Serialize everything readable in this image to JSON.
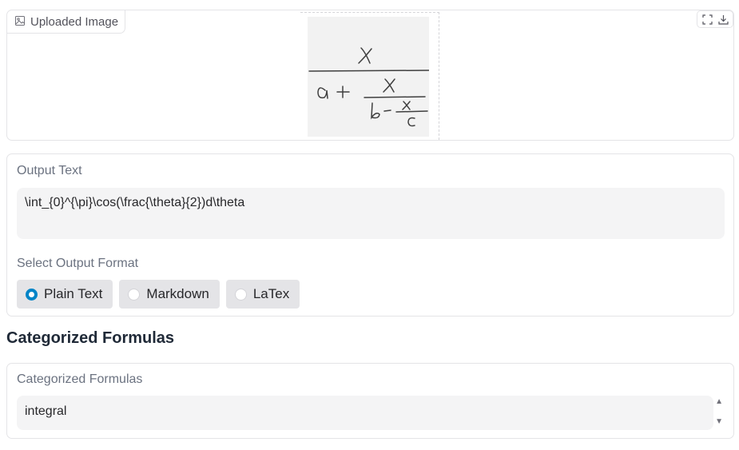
{
  "image_panel": {
    "label": "Uploaded Image",
    "icons": [
      "image-icon",
      "fullscreen-icon",
      "download-icon"
    ]
  },
  "output_panel": {
    "label": "Output Text",
    "value": "\\int_{0}^{\\pi}\\cos(\\frac{\\theta}{2})d\\theta",
    "format_label": "Select Output Format",
    "formats": [
      "Plain Text",
      "Markdown",
      "LaTex"
    ],
    "selected_format": "Plain Text"
  },
  "section": {
    "heading": "Categorized Formulas"
  },
  "categorized_panel": {
    "label": "Categorized Formulas",
    "value": "integral"
  },
  "colors": {
    "accent": "#0284c7",
    "field_bg": "#f4f4f5",
    "pill_bg": "#e4e4e7",
    "border": "#e4e4e7"
  }
}
